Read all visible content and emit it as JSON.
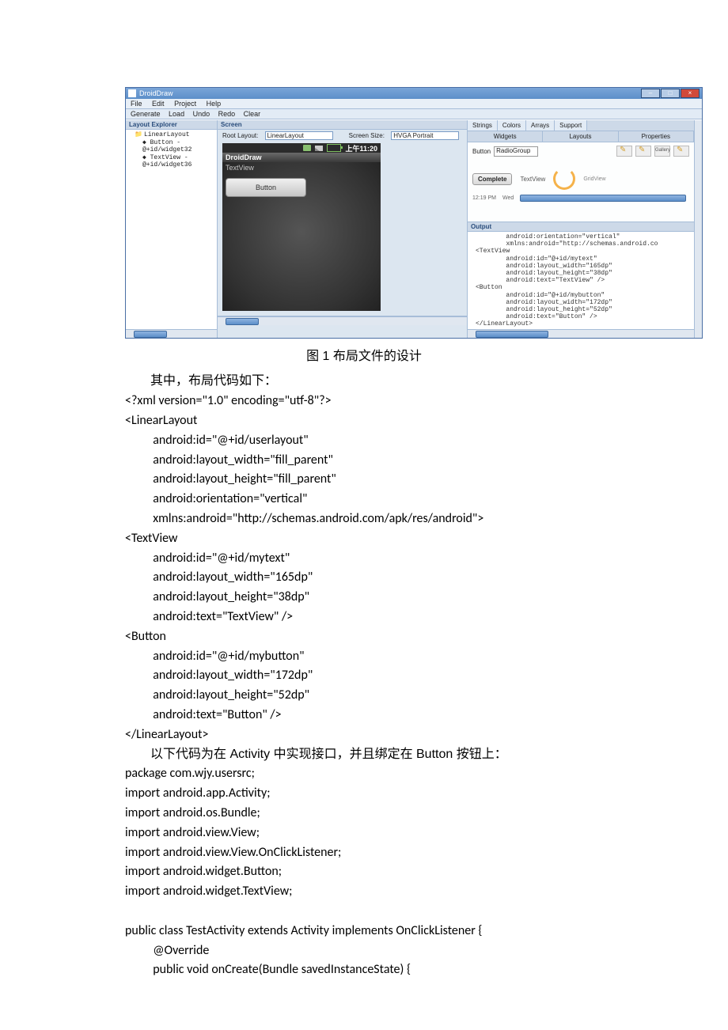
{
  "app": {
    "title": "DroidDraw",
    "menu": [
      "File",
      "Edit",
      "Project",
      "Help"
    ],
    "toolbar": [
      "Generate",
      "Load",
      "Undo",
      "Redo",
      "Clear"
    ]
  },
  "explorer": {
    "title": "Layout Explorer",
    "root": "LinearLayout",
    "children": [
      "Button - @+id/widget32",
      "TextView - @+id/widget36"
    ]
  },
  "screen": {
    "title": "Screen",
    "rootLayoutLabel": "Root Layout:",
    "rootLayoutValue": "LinearLayout",
    "screenSizeLabel": "Screen Size:",
    "screenSizeValue": "HVGA Portrait",
    "statusTime": "上午11:20",
    "phoneTitle": "DroidDraw",
    "textview": "TextView",
    "button": "Button"
  },
  "right": {
    "tabsTop": [
      "Strings",
      "Colors",
      "Arrays",
      "Support"
    ],
    "tabsBottom": [
      "Widgets",
      "Layouts",
      "Properties"
    ],
    "buttonLabel": "Button",
    "radioGroupValue": "RadioGroup",
    "completeBtn": "Complete",
    "textViewLabel": "TextView",
    "gridViewLabel": "GridView",
    "statusLeft": "12:19 PM",
    "statusRight": "Wed"
  },
  "output": {
    "title": "Output",
    "lines": [
      "        android:orientation=\"vertical\"",
      "        xmlns:android=\"http://schemas.android.co",
      "<TextView",
      "        android:id=\"@+id/mytext\"",
      "        android:layout_width=\"165dp\"",
      "        android:layout_height=\"38dp\"",
      "        android:text=\"TextView\" />",
      "<Button",
      "        android:id=\"@+id/mybutton\"",
      "        android:layout_width=\"172dp\"",
      "        android:layout_height=\"52dp\"",
      "        android:text=\"Button\" />",
      "</LinearLayout>"
    ]
  },
  "doc": {
    "caption": "图 1  布局文件的设计",
    "intro": "其中，布局代码如下：",
    "xml": [
      "<?xml version=\"1.0\" encoding=\"utf-8\"?>",
      "<LinearLayout",
      "    android:id=\"@+id/userlayout\"",
      "    android:layout_width=\"fill_parent\"",
      "    android:layout_height=\"fill_parent\"",
      "    android:orientation=\"vertical\"",
      "    xmlns:android=\"http://schemas.android.com/apk/res/android\">",
      "<TextView",
      "    android:id=\"@+id/mytext\"",
      "    android:layout_width=\"165dp\"",
      "    android:layout_height=\"38dp\"",
      "    android:text=\"TextView\" />",
      "<Button",
      "    android:id=\"@+id/mybutton\"",
      "    android:layout_width=\"172dp\"",
      "    android:layout_height=\"52dp\"",
      "    android:text=\"Button\" />",
      "</LinearLayout>"
    ],
    "para2": "以下代码为在 Activity 中实现接口，并且绑定在 Button 按钮上：",
    "java": [
      "package com.wjy.usersrc;",
      "import android.app.Activity;",
      "import android.os.Bundle;",
      "import android.view.View;",
      "import android.view.View.OnClickListener;",
      "import android.widget.Button;",
      "import android.widget.TextView;",
      "",
      "public class TestActivity extends Activity implements OnClickListener {",
      "    @Override",
      "    public void onCreate(Bundle savedInstanceState) {"
    ]
  }
}
